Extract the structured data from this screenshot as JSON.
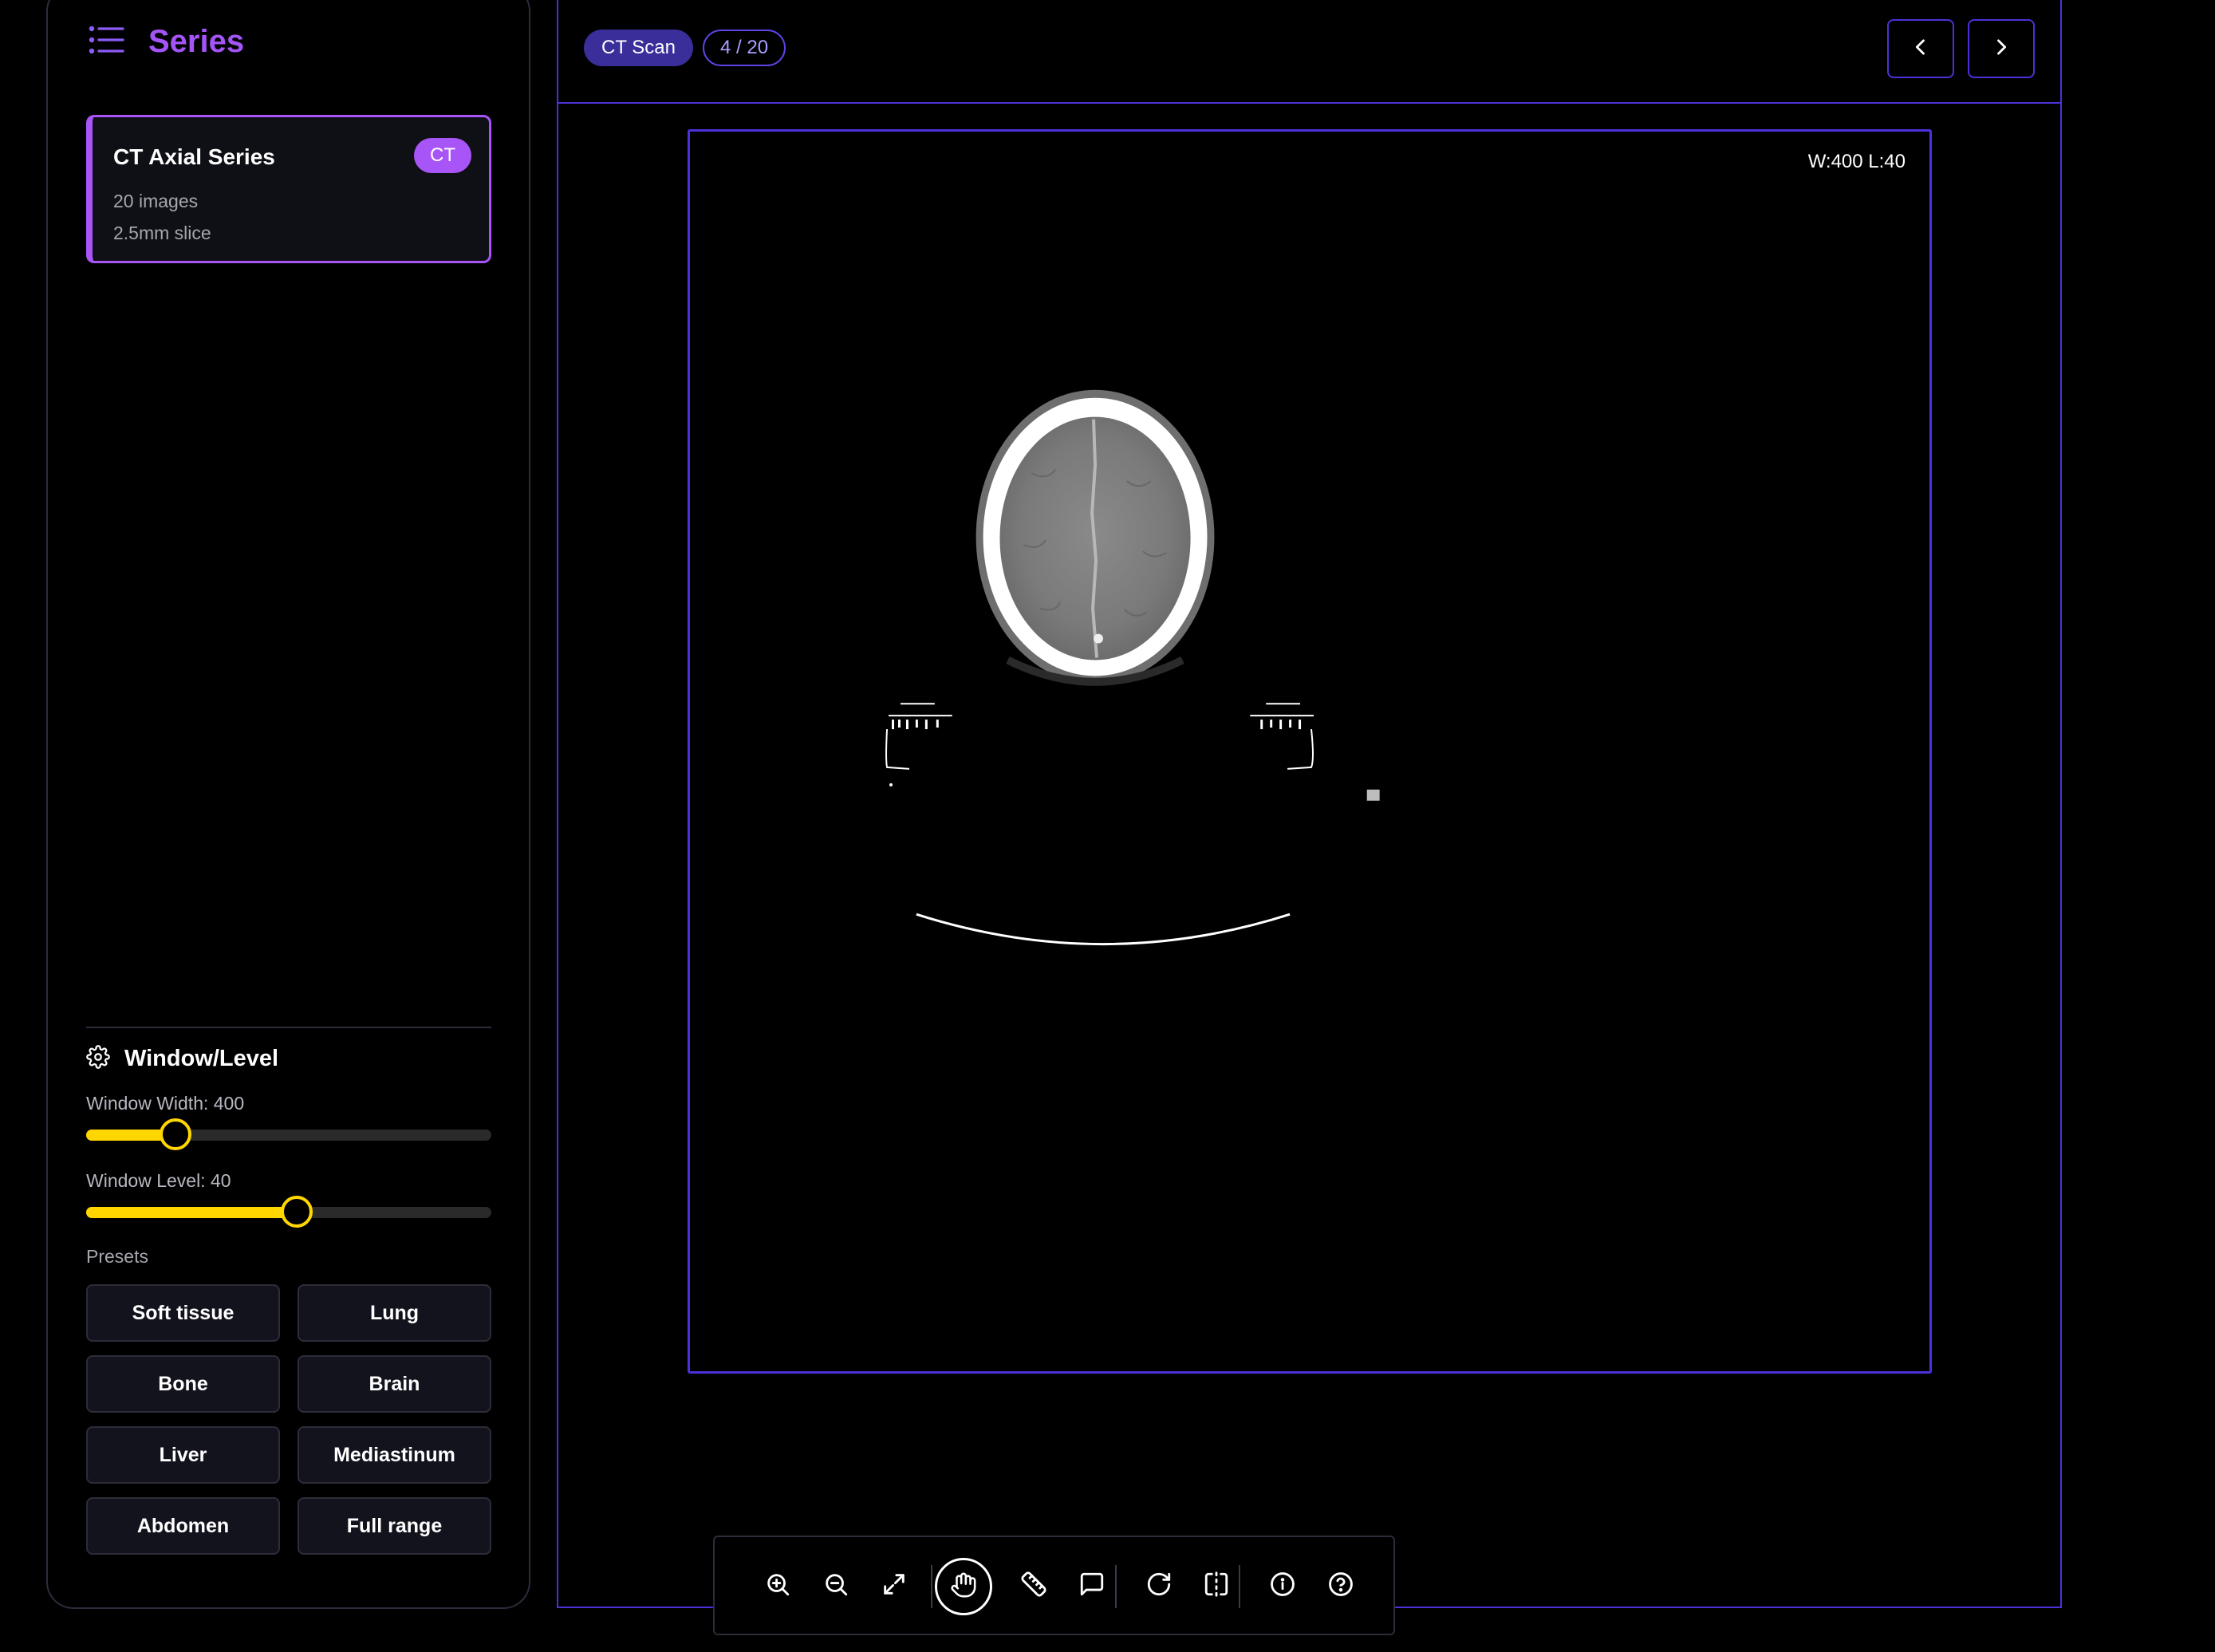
{
  "sidebar": {
    "title": "Series",
    "series": {
      "name": "CT Axial Series",
      "badge": "CT",
      "images": "20 images",
      "slice": "2.5mm slice"
    },
    "window_level": {
      "title": "Window/Level",
      "width_label": "Window Width: 400",
      "width_fraction": 0.22,
      "level_label": "Window Level: 40",
      "level_fraction": 0.52
    },
    "presets_label": "Presets",
    "presets": [
      "Soft tissue",
      "Lung",
      "Bone",
      "Brain",
      "Liver",
      "Mediastinum",
      "Abdomen",
      "Full range"
    ]
  },
  "viewer": {
    "modality": "CT Scan",
    "image_counter": "4 / 20",
    "overlay_wl": "W:400 L:40"
  },
  "toolbar": {
    "tools": [
      "zoom-in",
      "zoom-out",
      "fit-to-screen",
      "pan",
      "measure",
      "annotate",
      "reset-rotate",
      "flip",
      "info",
      "help"
    ],
    "active_tool": "pan"
  },
  "colors": {
    "accent_purple": "#a855f7",
    "border_indigo": "#4a32d8",
    "slider_yellow": "#ffd600",
    "background": "#000000"
  }
}
